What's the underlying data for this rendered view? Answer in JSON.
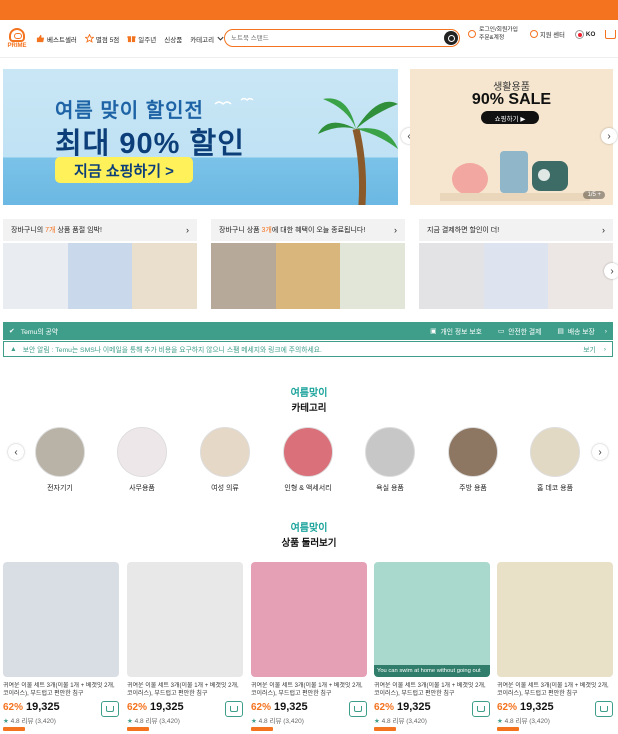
{
  "colors": {
    "brand": "#f4731f",
    "accent": "#3f9e8a"
  },
  "logo": {
    "text": "PRIME"
  },
  "nav": {
    "items": [
      {
        "label": "베스트셀러",
        "icon": "thumbs-up-icon"
      },
      {
        "label": "별점 5점",
        "icon": "star-icon"
      },
      {
        "label": "일주년",
        "icon": "gift-icon"
      },
      {
        "label": "신상품"
      },
      {
        "label": "카테고리",
        "icon": "chevron-down-icon"
      }
    ],
    "search_placeholder": "노트북 스탠드",
    "login_line1": "로그인/회원가입",
    "login_line2": "주문&계정",
    "support": "지원 센터",
    "lang": "KO"
  },
  "banner": {
    "line1": "여름 맞이 할인전",
    "line2": "최대 90% 할인",
    "cta": "지금 쇼핑하기 >"
  },
  "banner2": {
    "sub": "생활용품",
    "big": "90% SALE",
    "cta": "쇼핑하기 ▶",
    "counter": "1/5 +"
  },
  "promos": [
    {
      "pre": "장바구니의 ",
      "highlight": "7개",
      "post": " 상품 품절 임박!"
    },
    {
      "pre": "장바구니 상품 ",
      "highlight": "3개",
      "post": "에 대한 혜택이 오늘 종료됩니다!"
    },
    {
      "pre": "지금 결제하면 할인이 더!",
      "highlight": "",
      "post": ""
    }
  ],
  "trust": {
    "title": "Temu의 공약",
    "items": [
      "개인 정보 보호",
      "안전한 결제",
      "배송 보장"
    ]
  },
  "notice": {
    "text": "보안 알림 : Temu는 SMS나 이메일을 통해 추가 비용을 요구하지 않으니 스팸 메세지와 링크에 주의하세요.",
    "link": "보기"
  },
  "categories_section": {
    "deco": "여름맞이",
    "title": "카테고리"
  },
  "categories": [
    "전자기기",
    "사무용품",
    "여성 의류",
    "인형 & 액세서리",
    "욕실 용품",
    "주방 용품",
    "홈 데코 용품"
  ],
  "products_section": {
    "deco": "여름맞이",
    "title": "상품 둘러보기"
  },
  "product_overlay": "You can swim at home without going out",
  "products": [
    {
      "desc": "귀여운 이불 세트 3개(이불 1개 + 베갯잇 2개, 코이러스), 부드럽고 편안한 침구",
      "pct": "62%",
      "price": "19,325",
      "rating": "4.8",
      "reviews": "리뷰 (3,420)"
    },
    {
      "desc": "귀여운 이불 세트 3개(이불 1개 + 베갯잇 2개, 코이러스), 부드럽고 편안한 침구",
      "pct": "62%",
      "price": "19,325",
      "rating": "4.8",
      "reviews": "리뷰 (3,420)"
    },
    {
      "desc": "귀여운 이불 세트 3개(이불 1개 + 베갯잇 2개, 코이러스), 부드럽고 편안한 침구",
      "pct": "62%",
      "price": "19,325",
      "rating": "4.8",
      "reviews": "리뷰 (3,420)"
    },
    {
      "desc": "귀여운 이불 세트 3개(이불 1개 + 베갯잇 2개, 코이러스), 부드럽고 편안한 침구",
      "pct": "62%",
      "price": "19,325",
      "rating": "4.8",
      "reviews": "리뷰 (3,420)"
    },
    {
      "desc": "귀여운 이불 세트 3개(이불 1개 + 베갯잇 2개, 코이러스), 부드럽고 편안한 침구",
      "pct": "62%",
      "price": "19,325",
      "rating": "4.8",
      "reviews": "리뷰 (3,420)"
    }
  ]
}
